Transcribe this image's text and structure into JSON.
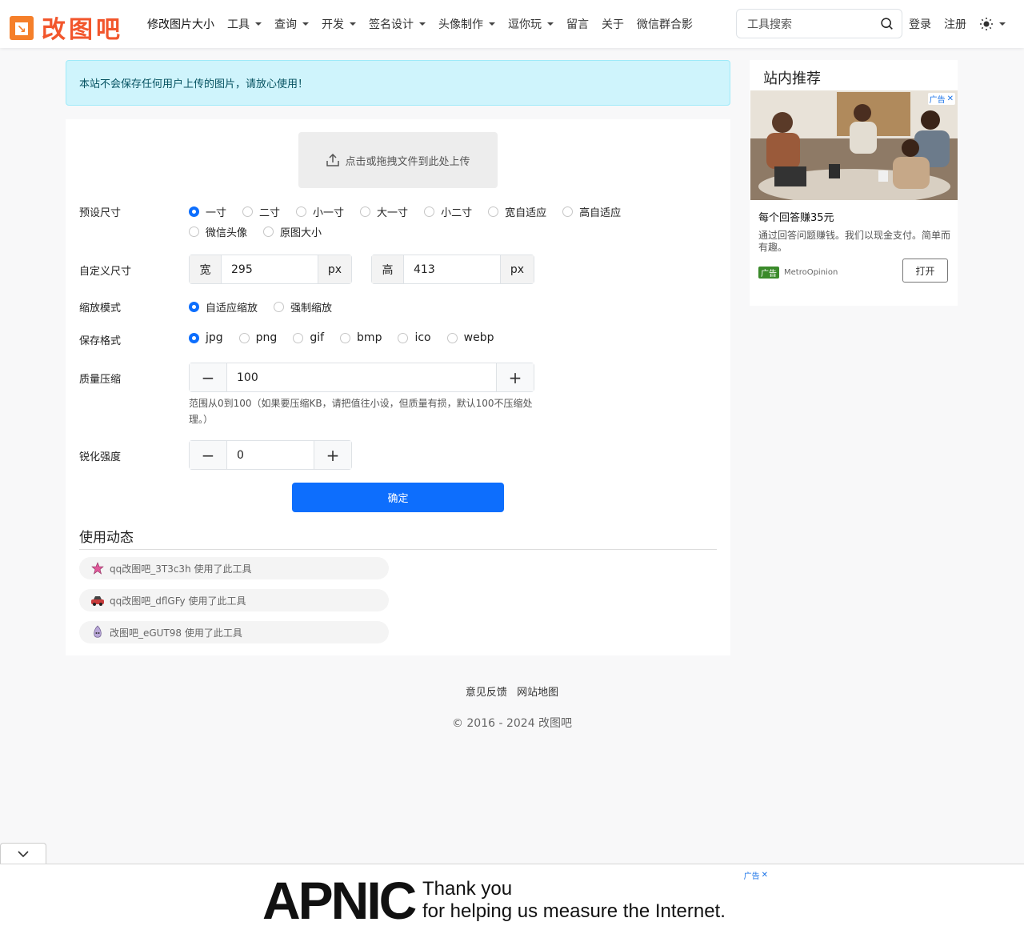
{
  "header": {
    "logo_text": "改图吧",
    "nav": [
      {
        "label": "修改图片大小",
        "dropdown": false
      },
      {
        "label": "工具",
        "dropdown": true
      },
      {
        "label": "查询",
        "dropdown": true
      },
      {
        "label": "开发",
        "dropdown": true
      },
      {
        "label": "签名设计",
        "dropdown": true
      },
      {
        "label": "头像制作",
        "dropdown": true
      },
      {
        "label": "逗你玩",
        "dropdown": true
      },
      {
        "label": "留言",
        "dropdown": false
      },
      {
        "label": "关于",
        "dropdown": false
      },
      {
        "label": "微信群合影",
        "dropdown": false
      }
    ],
    "search_placeholder": "工具搜索",
    "login": "登录",
    "register": "注册"
  },
  "alert": "本站不会保存任何用户上传的图片，请放心使用！",
  "upload_label": "点击或拖拽文件到此处上传",
  "form": {
    "preset": {
      "label": "预设尺寸",
      "options": [
        "一寸",
        "二寸",
        "小一寸",
        "大一寸",
        "小二寸",
        "宽自适应",
        "高自适应",
        "微信头像",
        "原图大小"
      ],
      "selected": "一寸"
    },
    "custom": {
      "label": "自定义尺寸",
      "width_prefix": "宽",
      "width_value": "295",
      "width_unit": "px",
      "height_prefix": "高",
      "height_value": "413",
      "height_unit": "px"
    },
    "scale": {
      "label": "缩放模式",
      "options": [
        "自适应缩放",
        "强制缩放"
      ],
      "selected": "自适应缩放"
    },
    "format": {
      "label": "保存格式",
      "options": [
        "jpg",
        "png",
        "gif",
        "bmp",
        "ico",
        "webp"
      ],
      "selected": "jpg"
    },
    "quality": {
      "label": "质量压缩",
      "value": "100",
      "hint": "范围从0到100（如果要压缩KB，请把值往小设，但质量有损，默认100不压缩处理。）"
    },
    "sharpen": {
      "label": "锐化强度",
      "value": "0"
    },
    "submit": "确定"
  },
  "activity": {
    "title": "使用动态",
    "items": [
      {
        "user": "qq改图吧_3T3c3h",
        "action": "使用了此工具",
        "avatar": "star-icon"
      },
      {
        "user": "qq改图吧_dflGFy",
        "action": "使用了此工具",
        "avatar": "car-icon"
      },
      {
        "user": "改图吧_eGUT98",
        "action": "使用了此工具",
        "avatar": "creature-icon"
      }
    ]
  },
  "sidebar": {
    "title": "站内推荐",
    "ad": {
      "badge": "广告",
      "headline": "每个回答赚35元",
      "description": "通过回答问题赚钱。我们以现金支付。简单而有趣。",
      "tag": "广告",
      "advertiser": "MetroOpinion",
      "cta": "打开"
    }
  },
  "footer": {
    "links": [
      "意见反馈",
      "网站地图"
    ],
    "copyright": "© 2016 - 2024 改图吧"
  },
  "bottom_ad": {
    "badge": "广告",
    "brand": "APNIC",
    "line1": "Thank you",
    "line2": "for helping us measure the Internet."
  },
  "colors": {
    "brand_orange": "#f2562c",
    "primary": "#0d6efd",
    "alert_bg": "#cff4fc"
  }
}
